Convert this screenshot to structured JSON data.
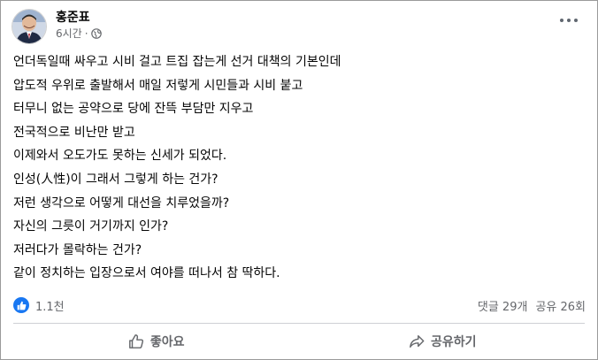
{
  "post": {
    "author": "홍준표",
    "timestamp": "6시간",
    "separator": "·",
    "audience_icon": "globe-icon",
    "more_icon": "more-options-icon",
    "lines": [
      "언더독일때 싸우고 시비 걸고 트집 잡는게 선거 대책의 기본인데",
      "압도적 우위로 출발해서 매일 저렇게 시민들과 시비 붙고",
      "터무니 없는 공약으로 당에 잔뜩 부담만 지우고",
      "전국적으로 비난만 받고",
      "이제와서 오도가도 못하는 신세가 되었다.",
      "인성(人性)이 그래서 그렇게 하는 건가?",
      "저런 생각으로 어떻게 대선을 치루었을까?",
      "자신의 그릇이 거기까지 인가?",
      "저러다가 몰락하는 건가?",
      "같이 정치하는 입장으로서 여야를 떠나서 참 딱하다."
    ]
  },
  "stats": {
    "reaction_count": "1.1천",
    "comments": "댓글 29개",
    "shares": "공유 26회",
    "reaction_color": "#1877f2"
  },
  "actions": {
    "like_label": "좋아요",
    "share_label": "공유하기"
  }
}
